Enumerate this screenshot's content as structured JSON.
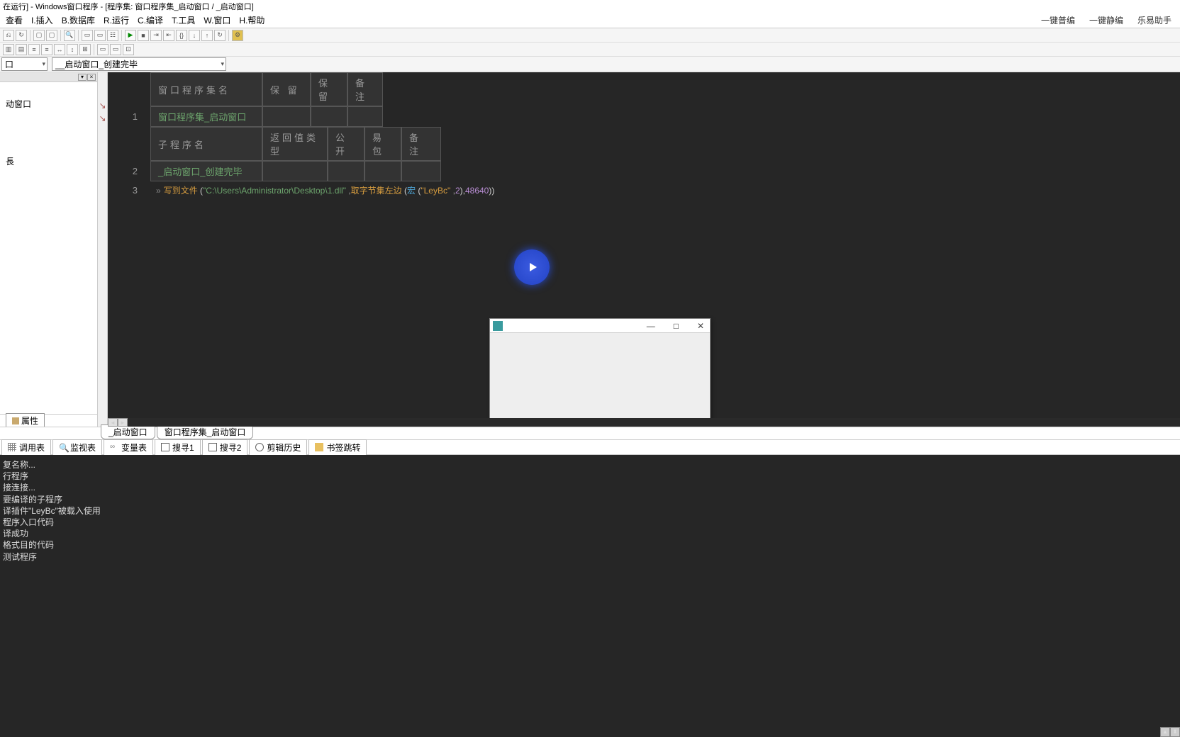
{
  "titlebar": "在运行] - Windows窗口程序 - [程序集: 窗口程序集_启动窗口 / _启动窗口]",
  "menu": {
    "items": [
      "查看",
      "I.插入",
      "B.数据库",
      "R.运行",
      "C.编译",
      "T.工具",
      "W.窗口",
      "H.帮助"
    ],
    "right": [
      "一键普编",
      "一键静编",
      "乐易助手"
    ]
  },
  "dropdowns": {
    "dd1": "口",
    "dd2": "__启动窗口_创建完毕"
  },
  "sidebar": {
    "item1": "动窗口",
    "item2": "長",
    "prop_tab": "属性"
  },
  "editor": {
    "header1": {
      "c1": "窗口程序集名",
      "c2": "保 留",
      "c3": "保 留",
      "c4": "备 注"
    },
    "row1_num": "1",
    "row1": {
      "c1": "窗口程序集_启动窗口"
    },
    "header2": {
      "c1": "子程序名",
      "c2": "返回值类型",
      "c3": "公开",
      "c4": "易包",
      "c5": "备 注"
    },
    "row2_num": "2",
    "row2": {
      "c1": "_启动窗口_创建完毕"
    },
    "row3_num": "3",
    "code3": {
      "fn1": "写到文件",
      "p1": "(",
      "str1": "\"C:\\Users\\Administrator\\Desktop\\1.dll\"",
      "comma1": ", ",
      "fn2": "取字节集左边",
      "p2": "(",
      "kw": "宏",
      "p3": "(",
      "str2": "\"LeyBc\"",
      "comma2": ", ",
      "num1": "2",
      "p4": "), ",
      "num2": "48640",
      "p5": "))"
    }
  },
  "bottom_tabs": {
    "t1": "_启动窗口",
    "t2": "窗口程序集_启动窗口"
  },
  "tabstrip": {
    "t1": "调用表",
    "t2": "监视表",
    "t3": "变量表",
    "t4": "搜寻1",
    "t5": "搜寻2",
    "t6": "剪辑历史",
    "t7": "书签跳转"
  },
  "console": {
    "l1": "复名称...",
    "l2": "行程序",
    "l3": "接连接...",
    "l4": "要编译的子程序",
    "l5": "",
    "l6": "译插件\"LeyBc\"被载入使用",
    "l7": "程序入口代码",
    "l8": "译成功",
    "l9": "格式目的代码",
    "l10": "测试程序"
  },
  "childwin": {
    "min": "—",
    "max": "□",
    "close": "✕"
  }
}
